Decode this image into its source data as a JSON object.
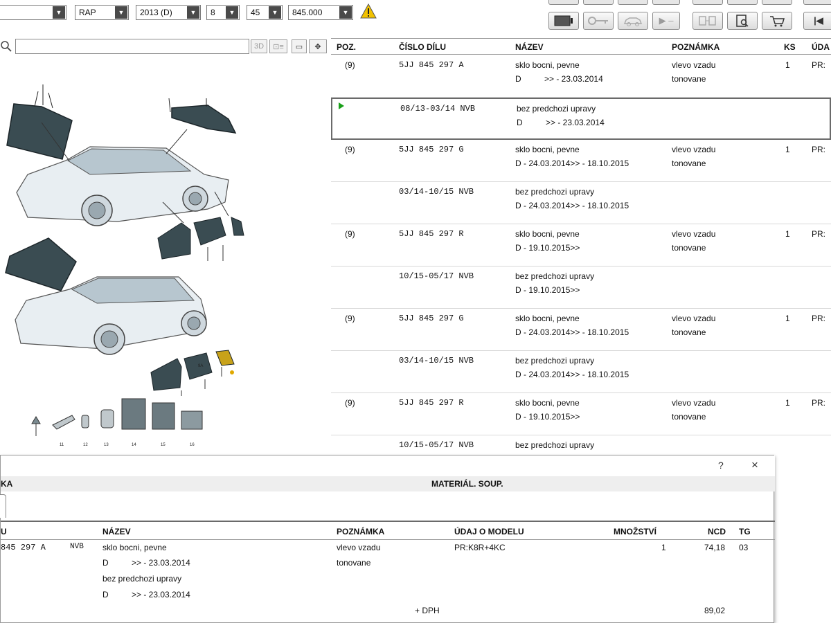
{
  "toolbar": {
    "selectors": [
      {
        "name": "selector-1",
        "value": ""
      },
      {
        "name": "selector-model",
        "value": "RAP"
      },
      {
        "name": "selector-year",
        "value": "2013 (D)"
      },
      {
        "name": "selector-group",
        "value": "8"
      },
      {
        "name": "selector-subgroup",
        "value": "45"
      },
      {
        "name": "selector-illustration",
        "value": "845.000"
      }
    ],
    "warning_icon": "warning-triangle-icon"
  },
  "left_panel": {
    "search_value": "",
    "view_3d_label": "3D",
    "callouts": [
      "9A",
      "11",
      "12",
      "13",
      "14",
      "15",
      "16"
    ]
  },
  "parts_table": {
    "headers": {
      "pos": "POZ.",
      "part_no": "ČÍSLO DÍLU",
      "name": "NÁZEV",
      "note": "POZNÁMKA",
      "qty": "KS",
      "model": "ÚDA"
    },
    "rows": [
      {
        "pos": "(9)",
        "part_no": "5JJ 845 297 A",
        "name1": "sklo bocni, pevne",
        "name2": "D          >> - 23.03.2014",
        "note1": "vlevo vzadu",
        "note2": "tonovane",
        "qty": "1",
        "model": "PR:",
        "selected": false
      },
      {
        "pos": "",
        "part_no": "08/13-03/14 NVB",
        "name1": "bez predchozi upravy",
        "name2": "D          >> - 23.03.2014",
        "note1": "",
        "note2": "",
        "qty": "",
        "model": "",
        "selected": true
      },
      {
        "pos": "(9)",
        "part_no": "5JJ 845 297 G",
        "name1": "sklo bocni, pevne",
        "name2": "D - 24.03.2014>> - 18.10.2015",
        "note1": "vlevo vzadu",
        "note2": "tonovane",
        "qty": "1",
        "model": "PR:",
        "selected": false
      },
      {
        "pos": "",
        "part_no": "03/14-10/15 NVB",
        "name1": "bez predchozi upravy",
        "name2": "D - 24.03.2014>> - 18.10.2015",
        "note1": "",
        "note2": "",
        "qty": "",
        "model": "",
        "selected": false
      },
      {
        "pos": "(9)",
        "part_no": "5JJ 845 297 R",
        "name1": "sklo bocni, pevne",
        "name2": "D - 19.10.2015>>",
        "note1": "vlevo vzadu",
        "note2": "tonovane",
        "qty": "1",
        "model": "PR:",
        "selected": false
      },
      {
        "pos": "",
        "part_no": "10/15-05/17 NVB",
        "name1": "bez predchozi upravy",
        "name2": "D - 19.10.2015>>",
        "note1": "",
        "note2": "",
        "qty": "",
        "model": "",
        "selected": false
      },
      {
        "pos": "(9)",
        "part_no": "5JJ 845 297 G",
        "name1": "sklo bocni, pevne",
        "name2": "D - 24.03.2014>> - 18.10.2015",
        "note1": "vlevo vzadu",
        "note2": "tonovane",
        "qty": "1",
        "model": "PR:",
        "selected": false
      },
      {
        "pos": "",
        "part_no": "03/14-10/15 NVB",
        "name1": "bez predchozi upravy",
        "name2": "D - 24.03.2014>> - 18.10.2015",
        "note1": "",
        "note2": "",
        "qty": "",
        "model": "",
        "selected": false
      },
      {
        "pos": "(9)",
        "part_no": "5JJ 845 297 R",
        "name1": "sklo bocni, pevne",
        "name2": "D - 19.10.2015>>",
        "note1": "vlevo vzadu",
        "note2": "tonovane",
        "qty": "1",
        "model": "PR:",
        "selected": false
      },
      {
        "pos": "",
        "part_no": "10/15-05/17 NVB",
        "name1": "bez predchozi upravy",
        "name2": "",
        "note1": "",
        "note2": "",
        "qty": "",
        "model": "",
        "selected": false
      }
    ]
  },
  "dialog": {
    "help_label": "?",
    "close_label": "×",
    "band_left": "KA",
    "band_center": "MATERIÁL. SOUP.",
    "headers": {
      "part": "U",
      "name": "NÁZEV",
      "note": "POZNÁMKA",
      "model": "ÚDAJ O MODELU",
      "qty": "MNOŽSTVÍ",
      "price": "NCD",
      "tg": "TG"
    },
    "row": {
      "part": "845 297 A",
      "flag": "NVB",
      "name1": "sklo bocni, pevne",
      "name2": "D          >> - 23.03.2014",
      "name3": "bez predchozi upravy",
      "name4": "D          >> - 23.03.2014",
      "note1": "vlevo vzadu",
      "note2": "tonovane",
      "model": "PR:K8R+4KC",
      "qty": "1",
      "price": "74,18",
      "tg": "03"
    },
    "vat_label": "+ DPH",
    "vat_total": "89,02"
  }
}
